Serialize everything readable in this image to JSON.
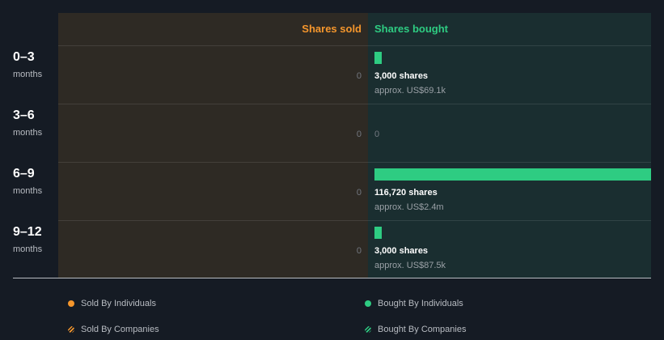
{
  "chart_data": {
    "type": "bar",
    "orientation": "horizontal",
    "title": "",
    "headers": {
      "sold": "Shares sold",
      "bought": "Shares bought"
    },
    "categories": [
      {
        "period": "0–3",
        "unit": "months"
      },
      {
        "period": "3–6",
        "unit": "months"
      },
      {
        "period": "6–9",
        "unit": "months"
      },
      {
        "period": "9–12",
        "unit": "months"
      }
    ],
    "series": [
      {
        "name": "Shares sold",
        "values": [
          0,
          0,
          0,
          0
        ],
        "labels": [
          "0",
          "0",
          "0",
          "0"
        ]
      },
      {
        "name": "Shares bought",
        "values": [
          3000,
          0,
          116720,
          3000
        ],
        "labels": [
          "3,000 shares",
          "0",
          "116,720 shares",
          "3,000 shares"
        ],
        "approx": [
          "approx. US$69.1k",
          "",
          "approx. US$2.4m",
          "approx. US$87.5k"
        ]
      }
    ],
    "xlim": [
      0,
      116720
    ],
    "colors": {
      "sold": "#f5962c",
      "bought": "#2ecc82"
    },
    "legend": {
      "placement": "bottom",
      "items": [
        {
          "label": "Sold By Individuals",
          "color": "#f5962c",
          "style": "solid"
        },
        {
          "label": "Bought By Individuals",
          "color": "#2ecc82",
          "style": "solid"
        },
        {
          "label": "Sold By Companies",
          "color": "#f5962c",
          "style": "hatched"
        },
        {
          "label": "Bought By Companies",
          "color": "#2ecc82",
          "style": "hatched"
        }
      ]
    }
  }
}
